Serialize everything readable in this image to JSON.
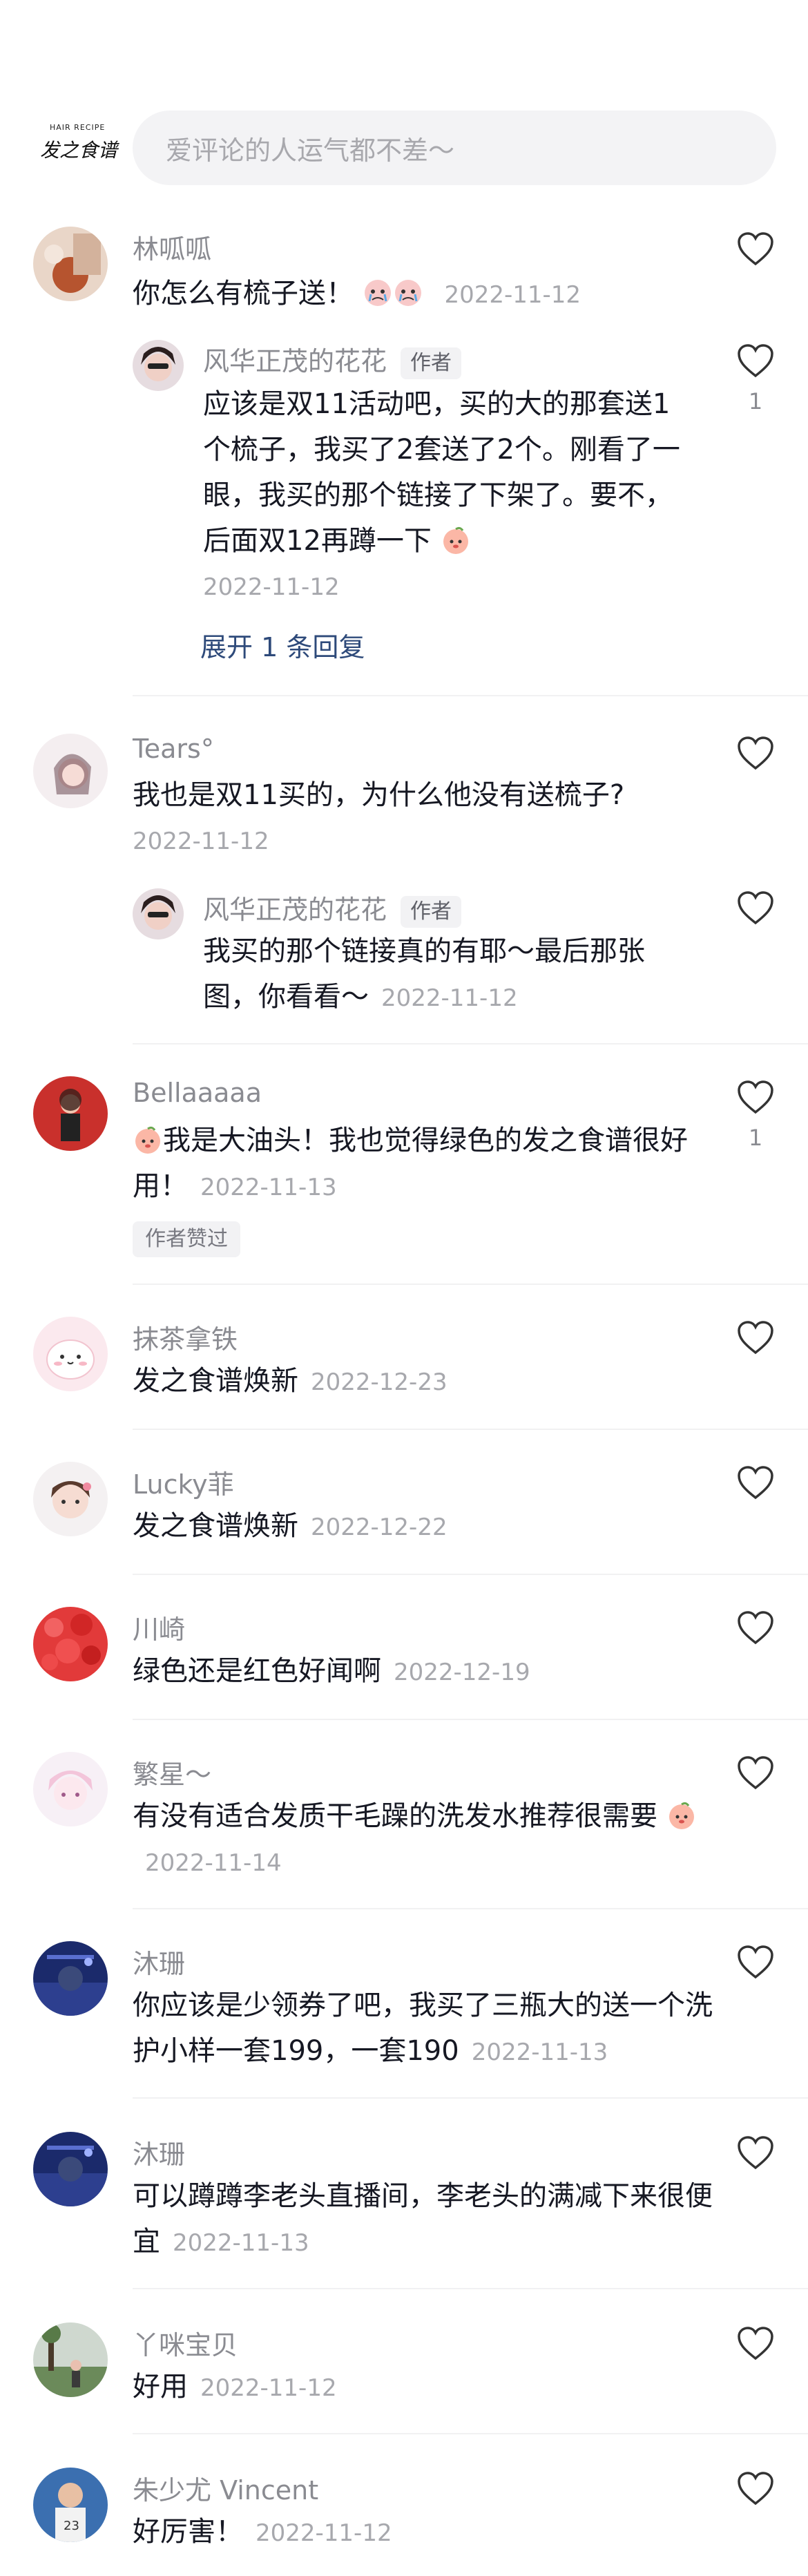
{
  "header": {
    "logo_small": "HAIR RECIPE",
    "logo_main": "发之食谱",
    "search_placeholder": "爱评论的人运气都不差～"
  },
  "comments": [
    {
      "name": "林呱呱",
      "text": "你怎么有梳子送！",
      "time": "2022-11-12",
      "reply": {
        "name": "风华正茂的花花",
        "tag": "作者",
        "text": "应该是双11活动吧，买的大的那套送1个梳子，我买了2套送了2个。刚看了一眼，我买的那个链接了下架了。要不，后面双12再蹲一下",
        "time": "2022-11-12",
        "likes": "1"
      },
      "expand": "展开 1 条回复"
    },
    {
      "name": "Tears°",
      "text": "我也是双11买的，为什么他没有送梳子?",
      "time": "2022-11-12",
      "reply": {
        "name": "风华正茂的花花",
        "tag": "作者",
        "text": "我买的那个链接真的有耶～最后那张图，你看看～",
        "time": "2022-11-12"
      }
    },
    {
      "name": "Bellaaaaa",
      "text": "我是大油头！我也觉得绿色的发之食谱很好用！",
      "time": "2022-11-13",
      "likes": "1",
      "badge": "作者赞过"
    },
    {
      "name": "抹茶拿铁",
      "text": "发之食谱焕新",
      "time": "2022-12-23"
    },
    {
      "name": "Lucky菲",
      "text": "发之食谱焕新",
      "time": "2022-12-22"
    },
    {
      "name": "川崎",
      "text": "绿色还是红色好闻啊",
      "time": "2022-12-19"
    },
    {
      "name": "繁星～",
      "text": "有没有适合发质干毛躁的洗发水推荐很需要",
      "time": "2022-11-14"
    },
    {
      "name": "沐珊",
      "text": "你应该是少领券了吧，我买了三瓶大的送一个洗护小样一套199，一套190",
      "time": "2022-11-13"
    },
    {
      "name": "沐珊",
      "text": "可以蹲蹲李老头直播间，李老头的满减下来很便宜",
      "time": "2022-11-13"
    },
    {
      "name": "丫咪宝贝",
      "text": "好用",
      "time": "2022-11-12"
    },
    {
      "name": "朱少尤 Vincent",
      "text": "好厉害！",
      "time": "2022-11-12"
    }
  ],
  "colors": {
    "text": "#161823",
    "meta": "#8a8b91",
    "time": "#a7a8ad",
    "link": "#2e4a7a",
    "search_bg": "#f3f3f5"
  }
}
